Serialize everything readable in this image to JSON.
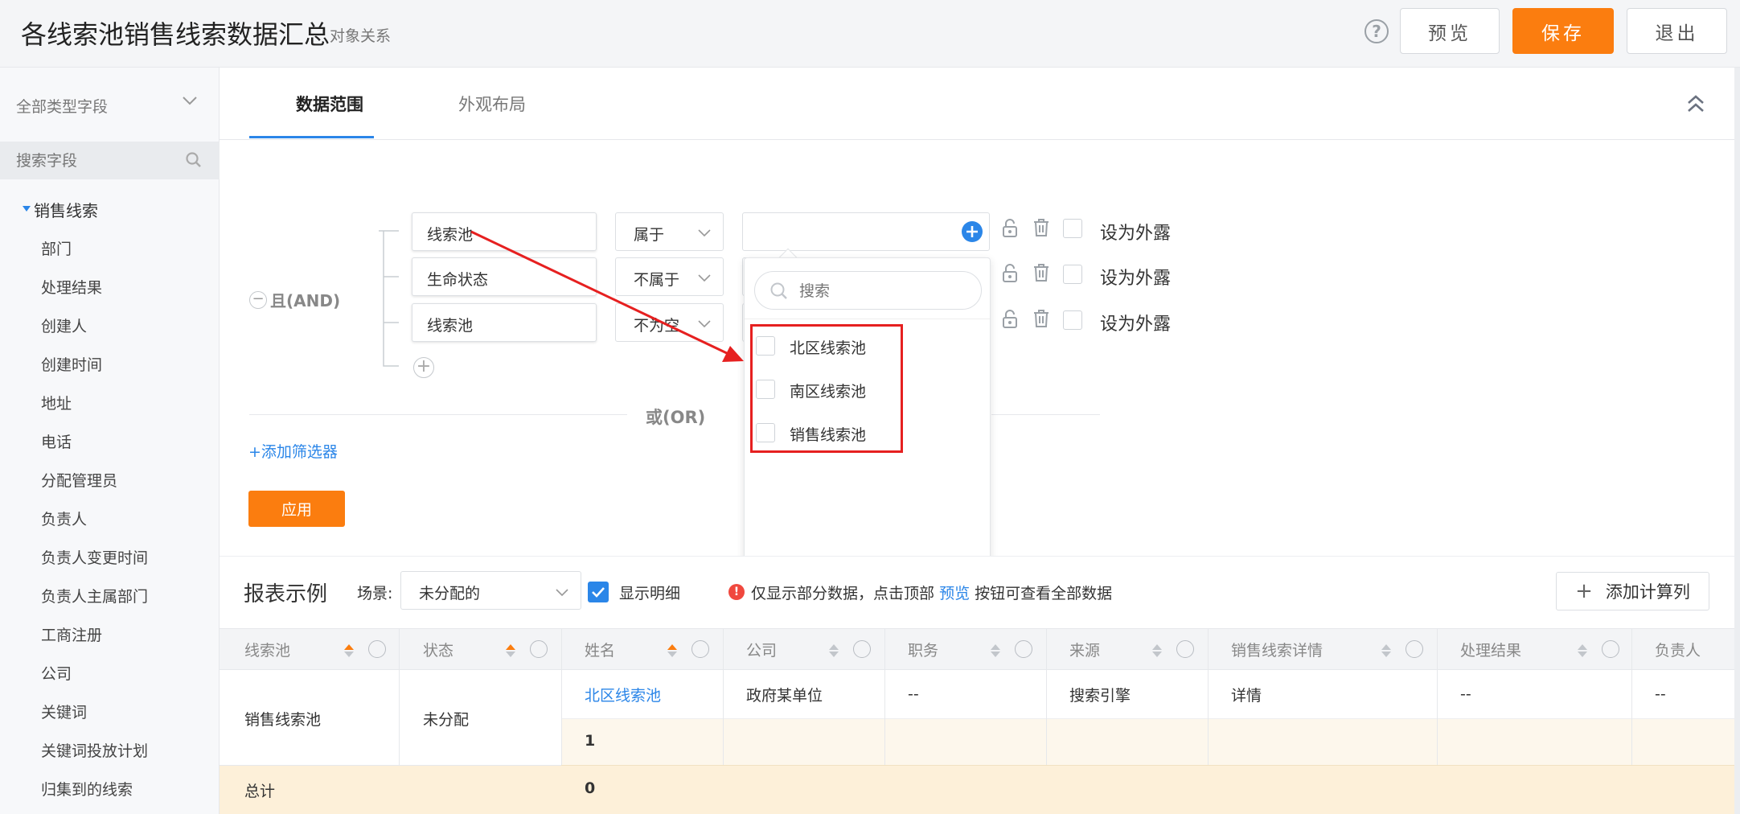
{
  "header": {
    "title": "各线索池销售线索数据汇总",
    "subtitle": "对象关系",
    "help_icon": "?",
    "preview_label": "预览",
    "save_label": "保存",
    "exit_label": "退出",
    "accent_color": "#fb7d0f"
  },
  "sidebar": {
    "field_type": "全部类型字段",
    "search_placeholder": "搜索字段",
    "group_label": "销售线索",
    "fields": [
      "部门",
      "处理结果",
      "创建人",
      "创建时间",
      "地址",
      "电话",
      "分配管理员",
      "负责人",
      "负责人变更时间",
      "负责人主属部门",
      "工商注册",
      "公司",
      "关键词",
      "关键词投放计划",
      "归集到的线索"
    ]
  },
  "tabs": {
    "data_scope": "数据范围",
    "appearance": "外观布局"
  },
  "filter": {
    "and_label": "且(AND)",
    "or_label": "或(OR)",
    "conditions": [
      {
        "field": "线索池",
        "operator": "属于",
        "expose_label": "设为外露"
      },
      {
        "field": "生命状态",
        "operator": "不属于",
        "expose_label": "设为外露"
      },
      {
        "field": "线索池",
        "operator": "不为空",
        "expose_label": "设为外露"
      }
    ],
    "add_filter": "+添加筛选器",
    "apply_label": "应用"
  },
  "dropdown": {
    "search_placeholder": "搜索",
    "options": [
      "北区线索池",
      "南区线索池",
      "销售线索池"
    ],
    "highlight_color": "#e62020"
  },
  "report": {
    "title": "报表示例",
    "scene_label": "场景:",
    "scene_value": "未分配的",
    "show_detail": "显示明细",
    "notice_prefix": "仅显示部分数据，点击顶部",
    "notice_link": "预览",
    "notice_suffix": "按钮可查看全部数据",
    "add_calc": "添加计算列",
    "columns": [
      "线索池",
      "状态",
      "姓名",
      "公司",
      "职务",
      "来源",
      "销售线索详情",
      "处理结果",
      "负责人"
    ],
    "row": {
      "pool": "销售线索池",
      "status": "未分配",
      "name": "北区线索池",
      "company": "政府某单位",
      "position": "--",
      "source": "搜索引擎",
      "detail": "详情",
      "result": "--",
      "owner": "--"
    },
    "subtotal": "1",
    "total_label": "总计",
    "total_value": "0"
  }
}
